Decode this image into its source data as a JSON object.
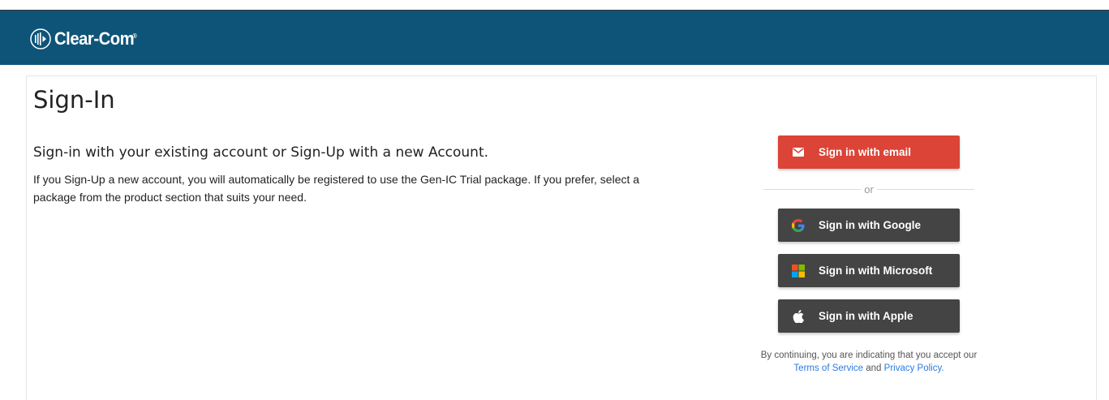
{
  "header": {
    "logo_text": "Clear-Com",
    "logo_tm": "®",
    "background_color": "#0e5478"
  },
  "main": {
    "title": "Sign-In",
    "lead": "Sign-in with your existing account or Sign-Up with a new Account.",
    "info": "If you Sign-Up a new account, you will automatically be registered to use the Gen-IC Trial package. If you prefer, select a package from the product section that suits your need."
  },
  "auth": {
    "email_label": "Sign in with email",
    "email_icon": "mail-icon",
    "email_color": "#db4437",
    "divider_text": "or",
    "google_label": "Sign in with Google",
    "google_icon": "google-icon",
    "microsoft_label": "Sign in with Microsoft",
    "microsoft_icon": "microsoft-icon",
    "apple_label": "Sign in with Apple",
    "apple_icon": "apple-icon",
    "dark_color": "#444444"
  },
  "legal": {
    "prefix": "By continuing, you are indicating that you accept our",
    "terms": "Terms of Service",
    "and": "and",
    "privacy": "Privacy Policy",
    "suffix": "."
  }
}
